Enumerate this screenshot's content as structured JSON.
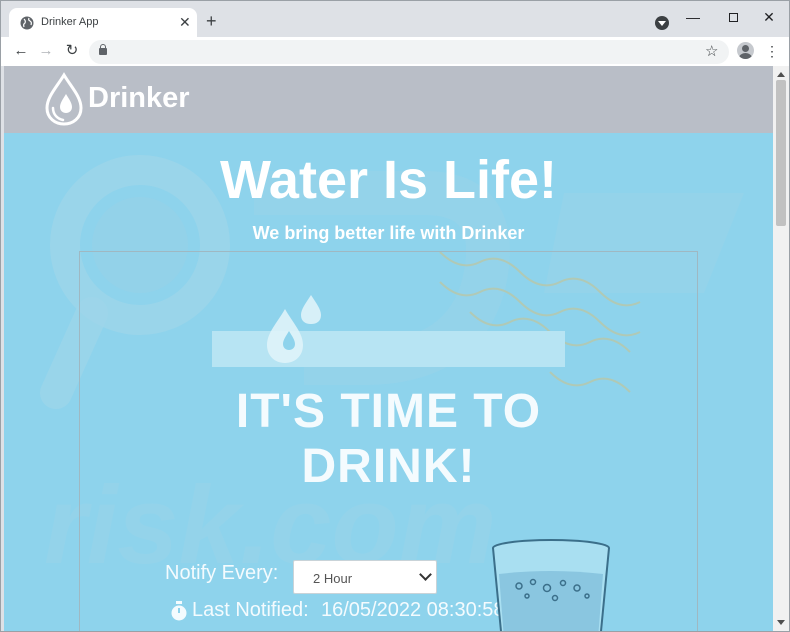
{
  "browser": {
    "tab_title": "Drinker App",
    "new_tab_glyph": "+",
    "close_glyph": "✕",
    "min_glyph": "—",
    "close_window_glyph": "✕",
    "back_glyph": "←",
    "forward_glyph": "→",
    "reload_glyph": "↻",
    "bookmark_glyph": "☆",
    "menu_glyph": "⋮"
  },
  "site": {
    "logo_text": "Drinker",
    "hero_title": "Water Is Life!",
    "hero_subtitle": "We bring better life with Drinker"
  },
  "promo": {
    "headline_line1": "IT'S TIME TO",
    "headline_line2": "DRINK!",
    "notify_label": "Notify Every:",
    "notify_value": "2 Hour",
    "last_notified_label": "Last Notified:",
    "last_notified_value": "16/05/2022 08:30:58 PM"
  },
  "colors": {
    "page_background": "#8ed3ec",
    "header_background": "#b9bec7",
    "text_white": "#ffffff"
  },
  "icons": [
    "globe-icon",
    "search-tabs-icon",
    "lock-icon",
    "star-icon",
    "profile-icon",
    "water-drop-logo-icon",
    "water-drops-icon",
    "stopwatch-icon",
    "water-glass-icon"
  ]
}
